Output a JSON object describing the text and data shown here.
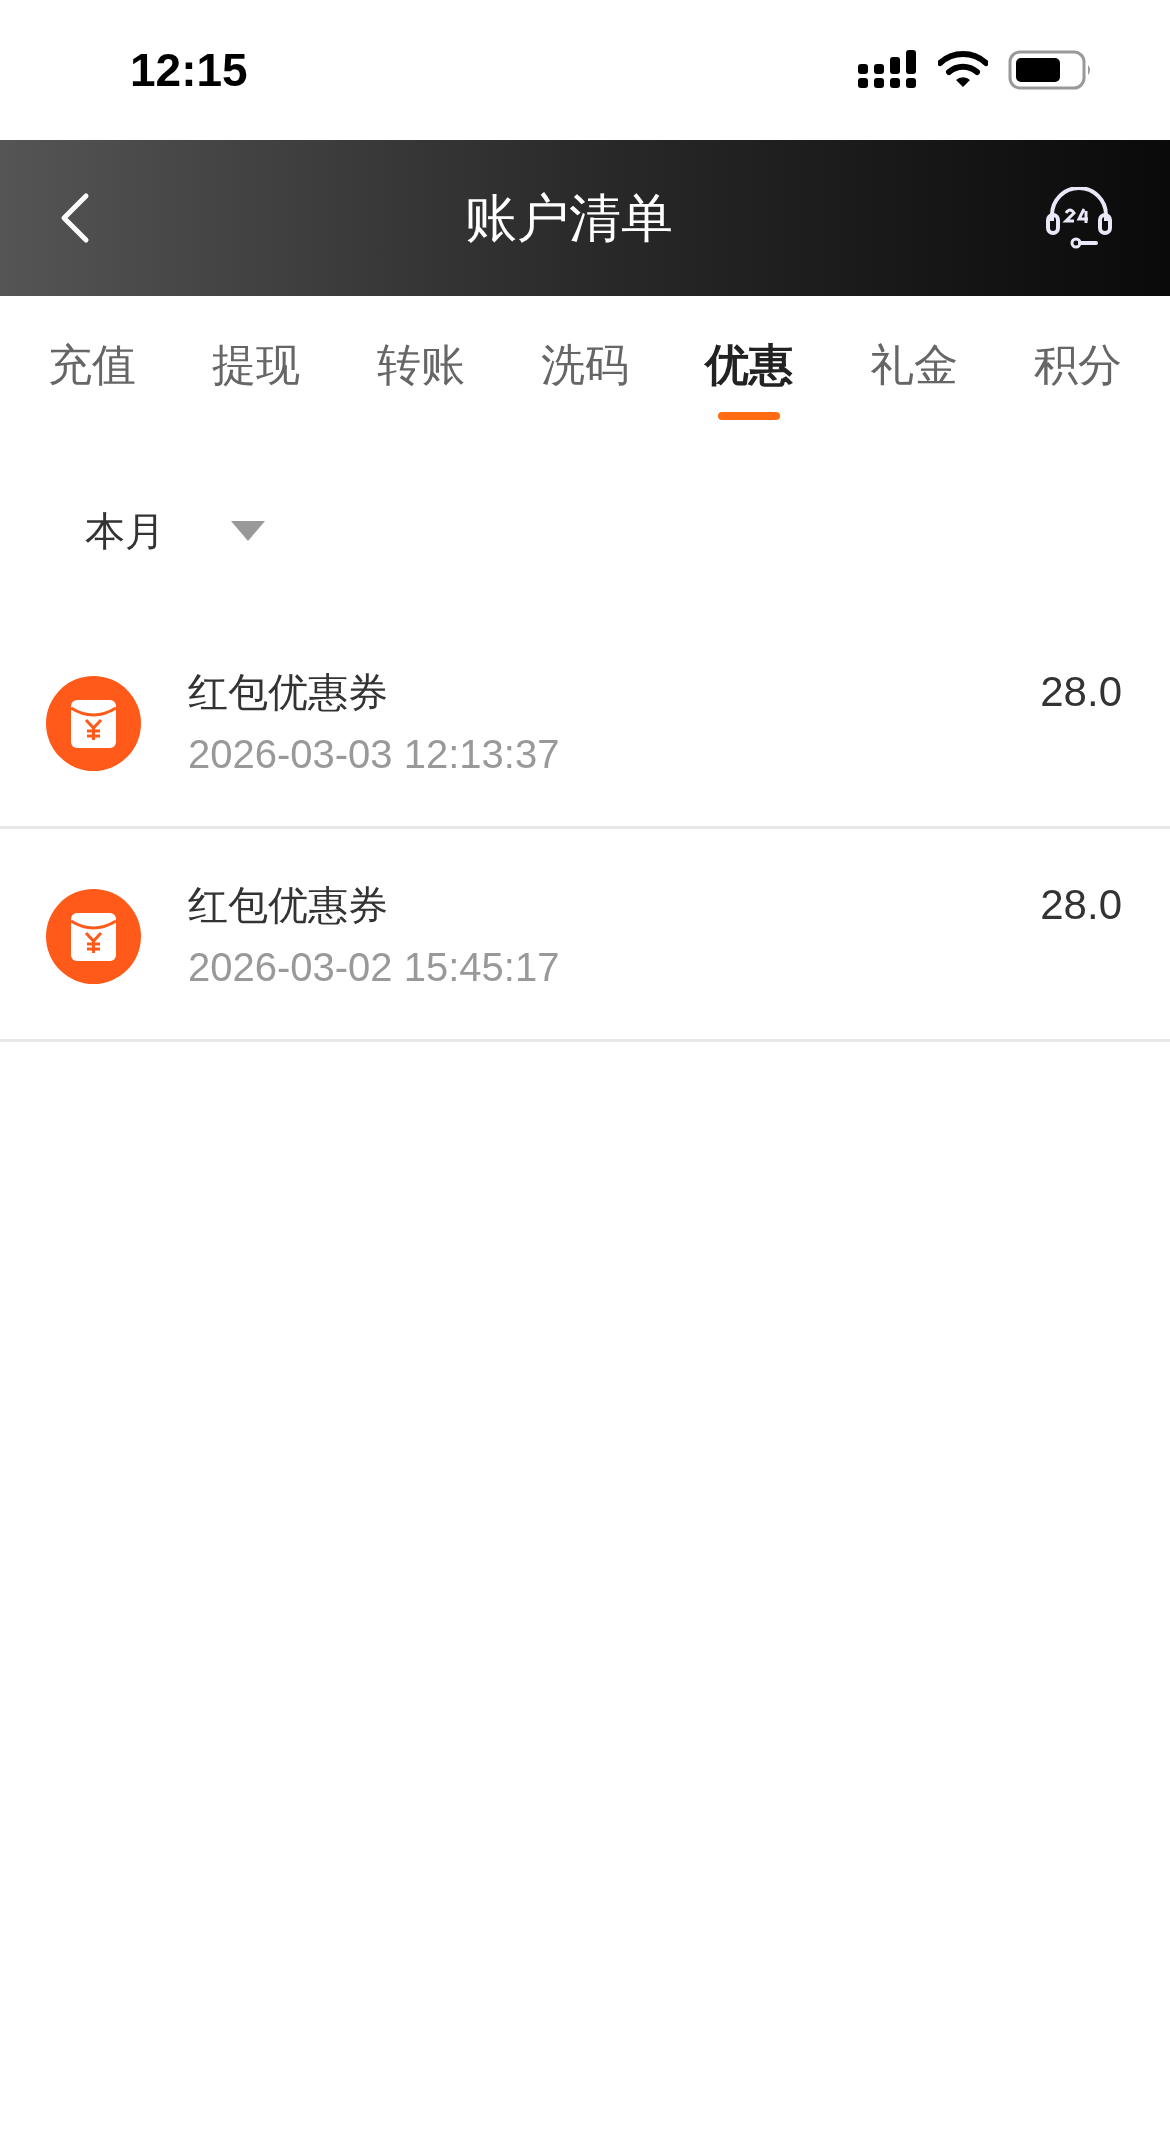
{
  "status_bar": {
    "time": "12:15"
  },
  "header": {
    "title": "账户清单"
  },
  "tabs": [
    {
      "label": "充值",
      "selected": false
    },
    {
      "label": "提现",
      "selected": false
    },
    {
      "label": "转账",
      "selected": false
    },
    {
      "label": "洗码",
      "selected": false
    },
    {
      "label": "优惠",
      "selected": true
    },
    {
      "label": "礼金",
      "selected": false
    },
    {
      "label": "积分",
      "selected": false
    }
  ],
  "filter": {
    "value": "本月"
  },
  "records": [
    {
      "title": "红包优惠券",
      "time": "2026-03-03 12:13:37",
      "amount": "28.0"
    },
    {
      "title": "红包优惠券",
      "time": "2026-03-02 15:45:17",
      "amount": "28.0"
    }
  ]
}
